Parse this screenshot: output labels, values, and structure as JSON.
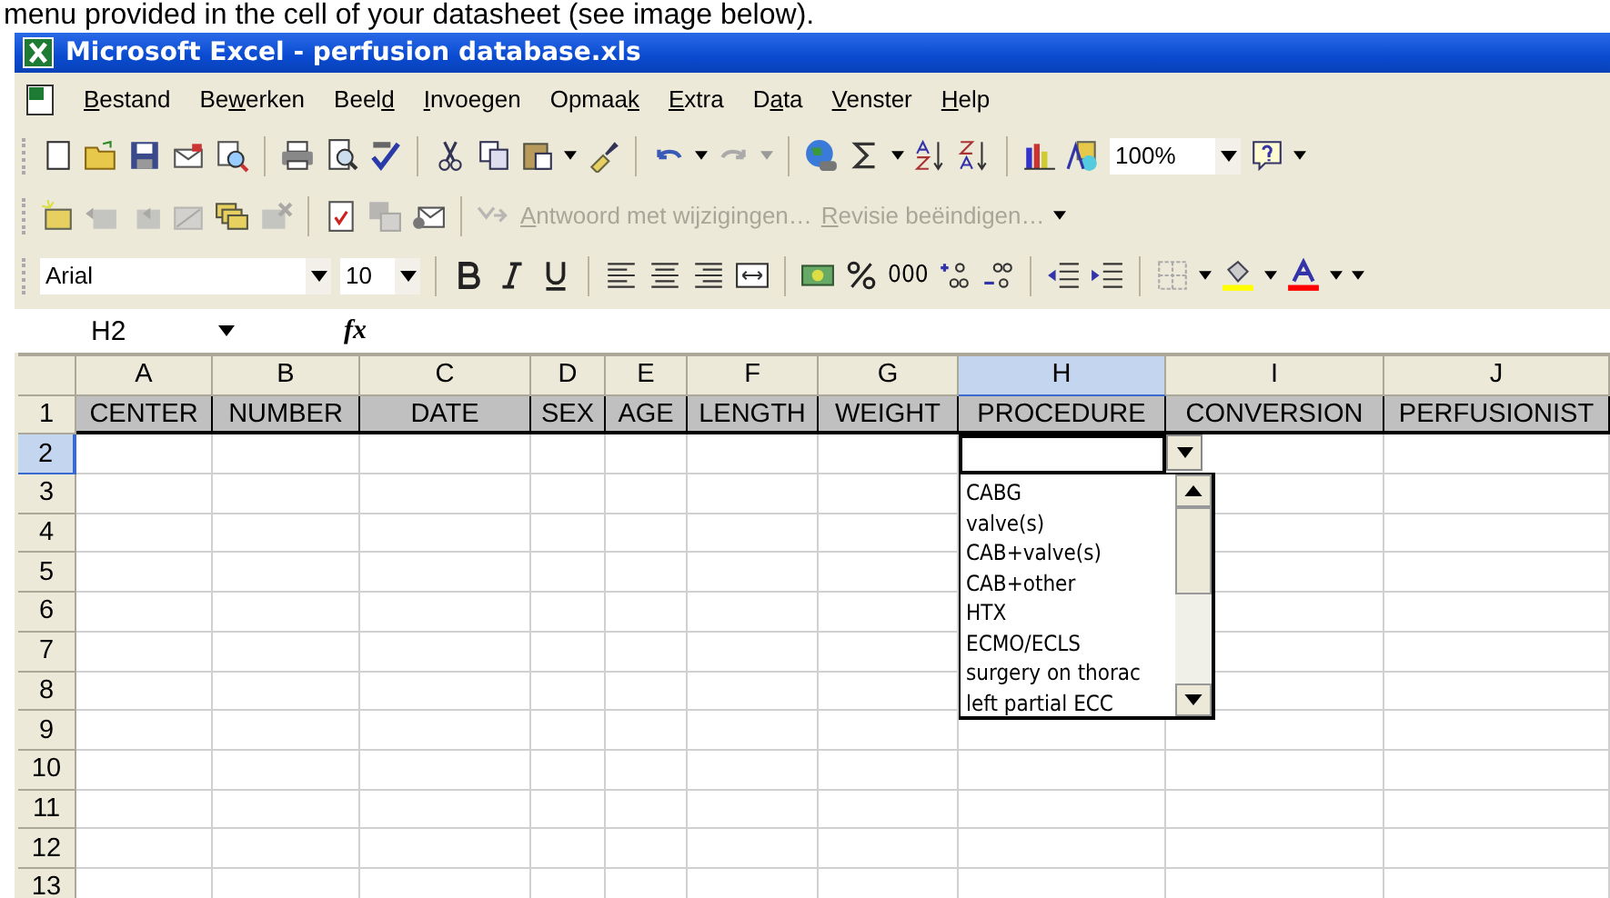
{
  "document_text": "menu provided in the cell of your datasheet (see image below).",
  "window": {
    "title": "Microsoft Excel - perfusion database.xls"
  },
  "menu": [
    {
      "key": "B",
      "post": "estand"
    },
    {
      "pre": "Be",
      "key": "w",
      "post": "erken"
    },
    {
      "pre": "Beel",
      "key": "d"
    },
    {
      "key": "I",
      "post": "nvoegen"
    },
    {
      "pre": "Opmaa",
      "key": "k"
    },
    {
      "key": "E",
      "post": "xtra"
    },
    {
      "pre": "D",
      "key": "a",
      "post": "ta"
    },
    {
      "key": "V",
      "post": "enster"
    },
    {
      "key": "H",
      "post": "elp"
    }
  ],
  "standard_toolbar": {
    "zoom": "100%"
  },
  "review_toolbar": {
    "items": [
      {
        "key": "A",
        "post": "ntwoord met wijzigingen…",
        "disabled": true
      },
      {
        "key": "R",
        "post": "evisie beëindigen…",
        "disabled": true
      }
    ]
  },
  "formatting_toolbar": {
    "font": "Arial",
    "size": "10",
    "thousands": "000"
  },
  "formula_bar": {
    "name_box": "H2",
    "fx": "fx"
  },
  "sheet": {
    "columns": [
      {
        "label": "A",
        "selected": false
      },
      {
        "label": "B",
        "selected": false
      },
      {
        "label": "C",
        "selected": false
      },
      {
        "label": "D",
        "selected": false
      },
      {
        "label": "E",
        "selected": false
      },
      {
        "label": "F",
        "selected": false
      },
      {
        "label": "G",
        "selected": false
      },
      {
        "label": "H",
        "selected": true
      },
      {
        "label": "I",
        "selected": false
      },
      {
        "label": "J",
        "selected": false
      }
    ],
    "rows": [
      {
        "label": "1",
        "selected": false,
        "cells": [
          "CENTER",
          "NUMBER",
          "DATE",
          "SEX",
          "AGE",
          "LENGTH",
          "WEIGHT",
          "PROCEDURE",
          "CONVERSION",
          "PERFUSIONIST"
        ]
      },
      {
        "label": "2",
        "selected": true
      },
      {
        "label": "3",
        "selected": false
      },
      {
        "label": "4",
        "selected": false
      },
      {
        "label": "5",
        "selected": false
      },
      {
        "label": "6",
        "selected": false
      },
      {
        "label": "7",
        "selected": false
      },
      {
        "label": "8",
        "selected": false
      },
      {
        "label": "9",
        "selected": false
      },
      {
        "label": "10",
        "selected": false
      },
      {
        "label": "11",
        "selected": false
      },
      {
        "label": "12",
        "selected": false
      },
      {
        "label": "13",
        "selected": false
      }
    ]
  },
  "dropdown": {
    "items": [
      "CABG",
      "valve(s)",
      "CAB+valve(s)",
      "CAB+other",
      "HTX",
      "ECMO/ECLS",
      "surgery on thorac",
      "left partial ECC"
    ]
  }
}
